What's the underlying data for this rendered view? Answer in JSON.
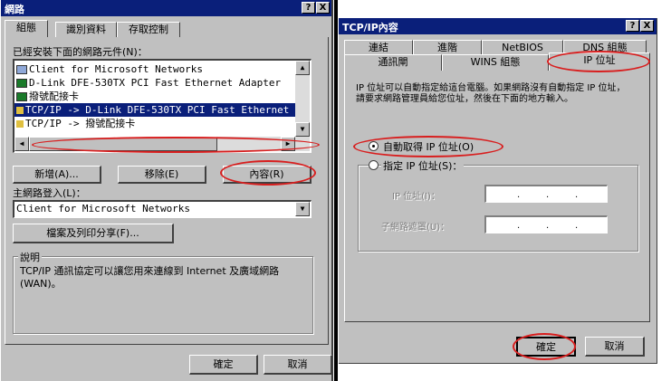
{
  "left_window": {
    "title": "網路",
    "title_buttons": [
      "?",
      "X"
    ],
    "tabs": [
      "組態",
      "識別資料",
      "存取控制"
    ],
    "installed_label": "已經安裝下面的網路元件(N)：",
    "components": [
      {
        "label": "Client for Microsoft Networks",
        "icon": "client-icon"
      },
      {
        "label": "D-Link DFE-530TX PCI Fast Ethernet Adapter",
        "icon": "network-adapter-icon"
      },
      {
        "label": "撥號配接卡",
        "icon": "network-adapter-icon"
      },
      {
        "label": "TCP/IP -> D-Link DFE-530TX PCI Fast Ethernet",
        "icon": "protocol-icon",
        "selected": true
      },
      {
        "label": "TCP/IP -> 撥號配接卡",
        "icon": "protocol-icon"
      }
    ],
    "buttons": {
      "add": "新增(A)...",
      "remove": "移除(E)",
      "properties": "內容(R)"
    },
    "primary_logon_label": "主網路登入(L)：",
    "primary_logon_value": "Client for Microsoft Networks",
    "file_print_button": "檔案及列印分享(F)...",
    "description_group": "說明",
    "description_text": "TCP/IP 通訊協定可以讓您用來連線到 Internet 及廣域網路 (WAN)。",
    "ok": "確定",
    "cancel": "取消"
  },
  "right_window": {
    "title": "TCP/IP內容",
    "title_buttons": [
      "?",
      "X"
    ],
    "tabs_row1": [
      "連結",
      "進階",
      "NetBIOS",
      "DNS 組態"
    ],
    "tabs_row2": [
      "通訊閘",
      "WINS 組態",
      "IP 位址"
    ],
    "active_tab": "IP 位址",
    "intro_text": "IP 位址可以自動指定給這台電腦。如果網路沒有自動指定 IP 位址，請要求網路管理員給您位址，然後在下面的地方輸入。",
    "radio_auto": "自動取得 IP 位址(O)",
    "radio_manual": "指定 IP 位址(S)：",
    "ip_label": "IP 位址(I)：",
    "subnet_label": "子網路遮罩(U)：",
    "ok": "確定",
    "cancel": "取消"
  },
  "colors": {
    "titlebar": "#0a1f7a",
    "face": "#c0c0c0",
    "selection": "#0a1f7a",
    "annotation": "#d81e1e"
  }
}
